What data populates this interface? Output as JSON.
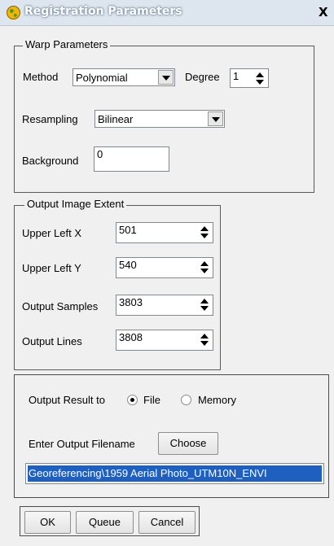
{
  "window": {
    "title": "Registration Parameters",
    "close_label": "X",
    "icon": "globe-app-icon"
  },
  "warp": {
    "legend": "Warp Parameters",
    "method_label": "Method",
    "method_value": "Polynomial",
    "degree_label": "Degree",
    "degree_value": "1",
    "resampling_label": "Resampling",
    "resampling_value": "Bilinear",
    "background_label": "Background",
    "background_value": "0"
  },
  "extent": {
    "legend": "Output Image Extent",
    "upper_left_x_label": "Upper Left X",
    "upper_left_x_value": "501",
    "upper_left_y_label": "Upper Left Y",
    "upper_left_y_value": "540",
    "samples_label": "Output Samples",
    "samples_value": "3803",
    "lines_label": "Output Lines",
    "lines_value": "3808"
  },
  "output": {
    "result_label": "Output Result to",
    "file_label": "File",
    "memory_label": "Memory",
    "selected": "File",
    "filename_label": "Enter Output Filename",
    "choose_label": "Choose",
    "filename_value": "Georeferencing\\1959 Aerial Photo_UTM10N_ENVI"
  },
  "buttons": {
    "ok": "OK",
    "queue": "Queue",
    "cancel": "Cancel"
  },
  "colors": {
    "selection": "#1f5fbf",
    "titlebar": "#dde6ef"
  }
}
